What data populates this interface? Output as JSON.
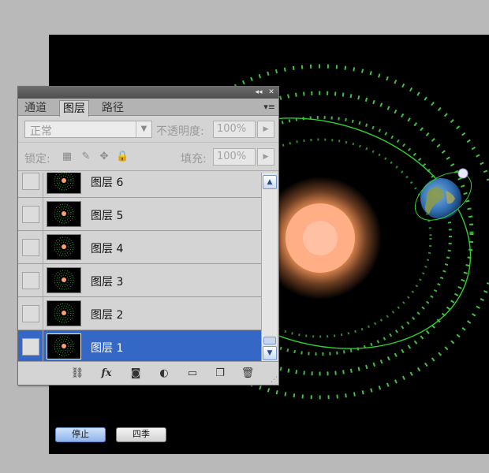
{
  "panel": {
    "tabs": [
      {
        "label": "通道",
        "active": false
      },
      {
        "label": "图层",
        "active": true
      },
      {
        "label": "路径",
        "active": false
      }
    ],
    "menu_glyph": "▾≡",
    "collapse_glyph": "◂◂",
    "close_glyph": "✕",
    "blend_mode": "正常",
    "opacity_label": "不透明度:",
    "opacity_value": "100%",
    "lock_label": "锁定:",
    "fill_label": "填充:",
    "fill_value": "100%",
    "layers": [
      {
        "name": "图层 6",
        "selected": false
      },
      {
        "name": "图层 5",
        "selected": false
      },
      {
        "name": "图层 4",
        "selected": false
      },
      {
        "name": "图层 3",
        "selected": false
      },
      {
        "name": "图层 2",
        "selected": false
      },
      {
        "name": "图层 1",
        "selected": true
      }
    ],
    "footer_icons": [
      "link-icon",
      "fx-icon",
      "layer-mask-icon",
      "adjustment-layer-icon",
      "folder-icon",
      "new-layer-icon",
      "trash-icon"
    ],
    "fx_label": "fx"
  },
  "canvas": {
    "stop_button": "停止",
    "season_button": "四季"
  },
  "colors": {
    "canvas_bg": "#000000",
    "selected_row": "#3467c6",
    "orbit_green": "#3fd33f",
    "sun_core": "#ffb08a"
  }
}
